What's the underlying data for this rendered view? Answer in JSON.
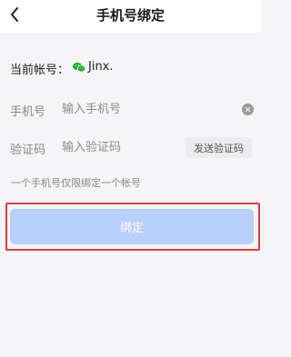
{
  "nav": {
    "title": "手机号绑定",
    "back_icon": "chevron-left-icon"
  },
  "account": {
    "label": "当前帐号：",
    "icon": "wechat-icon",
    "icon_color": "#1aad19",
    "name": "Jinx."
  },
  "form": {
    "phone": {
      "label": "手机号",
      "placeholder": "输入手机号",
      "value": ""
    },
    "code": {
      "label": "验证码",
      "placeholder": "输入验证码",
      "value": "",
      "send_label": "发送验证码"
    }
  },
  "hint": "一个手机号仅限绑定一个帐号",
  "bind_button": {
    "label": "绑定",
    "color": "#b8d0fb",
    "highlight_color": "#e23a3a"
  }
}
